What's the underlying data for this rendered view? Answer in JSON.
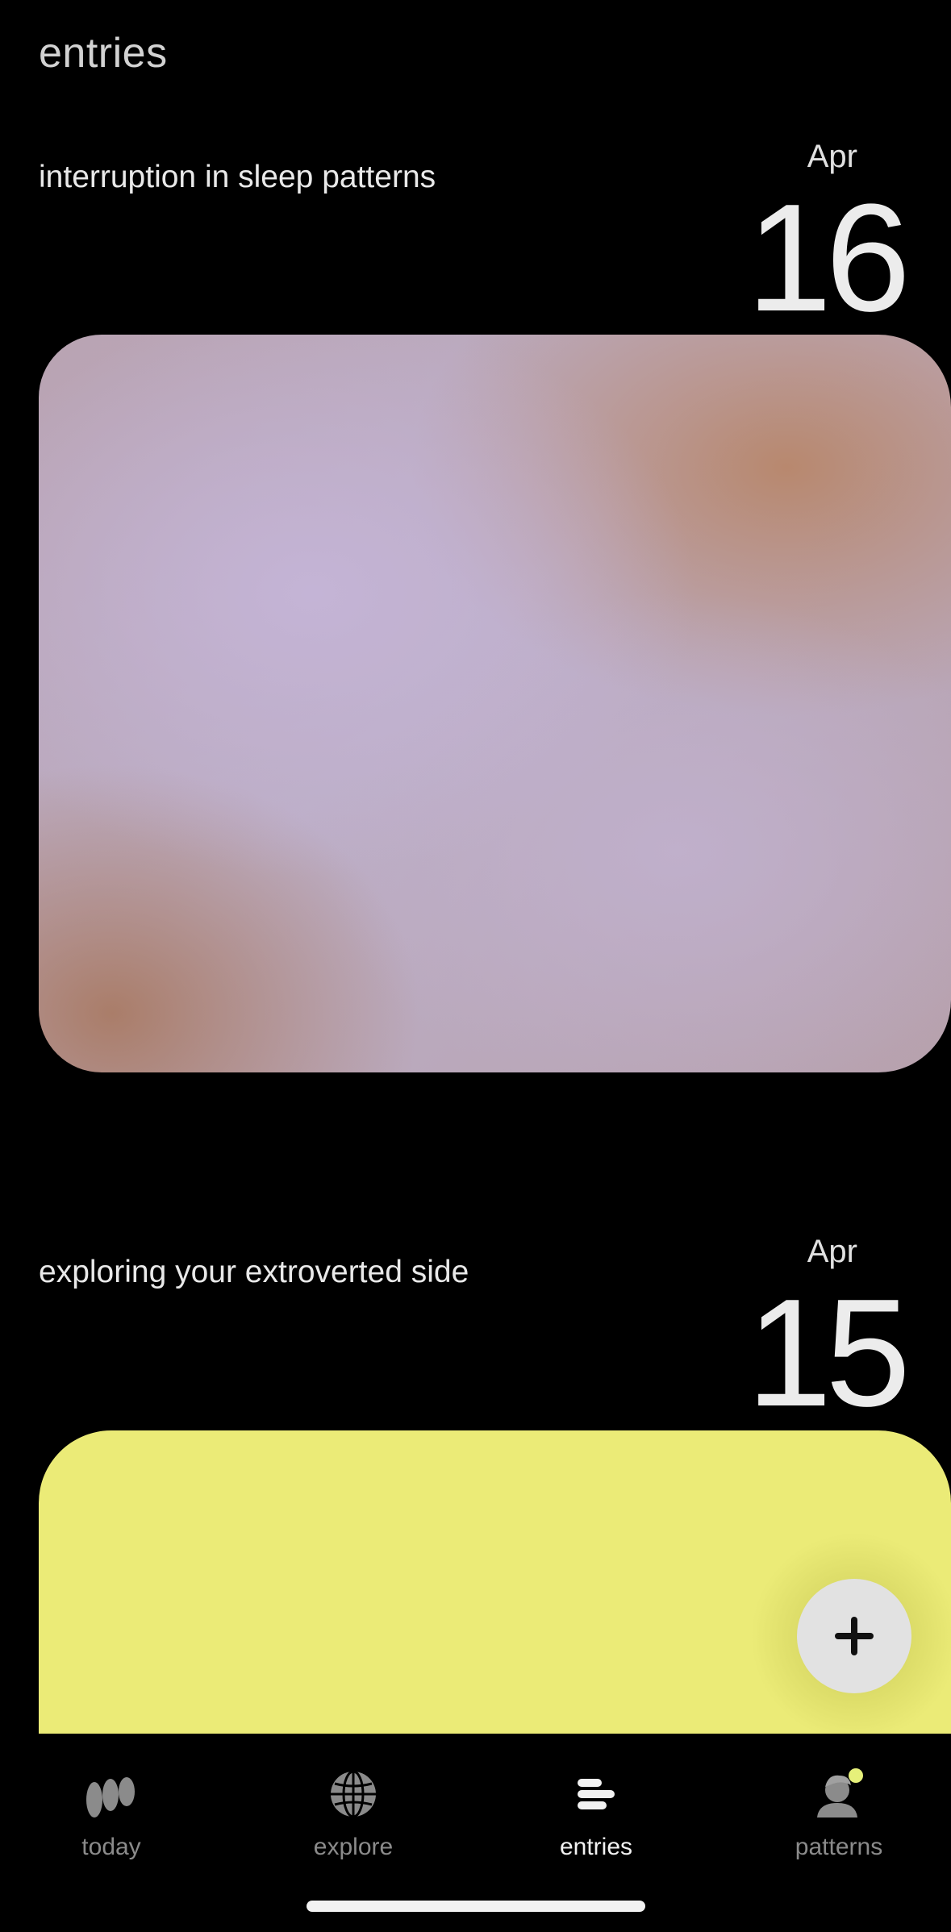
{
  "header": {
    "title": "entries"
  },
  "entries": [
    {
      "title": "interruption in sleep patterns",
      "month": "Apr",
      "day": "16"
    },
    {
      "title": "exploring your extroverted side",
      "month": "Apr",
      "day": "15"
    }
  ],
  "colors": {
    "background": "#000000",
    "card_yellow": "#ebeb77",
    "card_lilac": "#bcaec6",
    "card_peach": "#b8886e",
    "fab": "#e2e2e2",
    "patterns_dot": "#e6f07a"
  },
  "fab": {
    "icon": "plus-icon"
  },
  "tabbar": {
    "active": "entries",
    "tabs": [
      {
        "label": "today",
        "icon": "today-logo-icon"
      },
      {
        "label": "explore",
        "icon": "globe-icon"
      },
      {
        "label": "entries",
        "icon": "entries-lines-icon"
      },
      {
        "label": "patterns",
        "icon": "patterns-avatar-icon"
      }
    ]
  }
}
